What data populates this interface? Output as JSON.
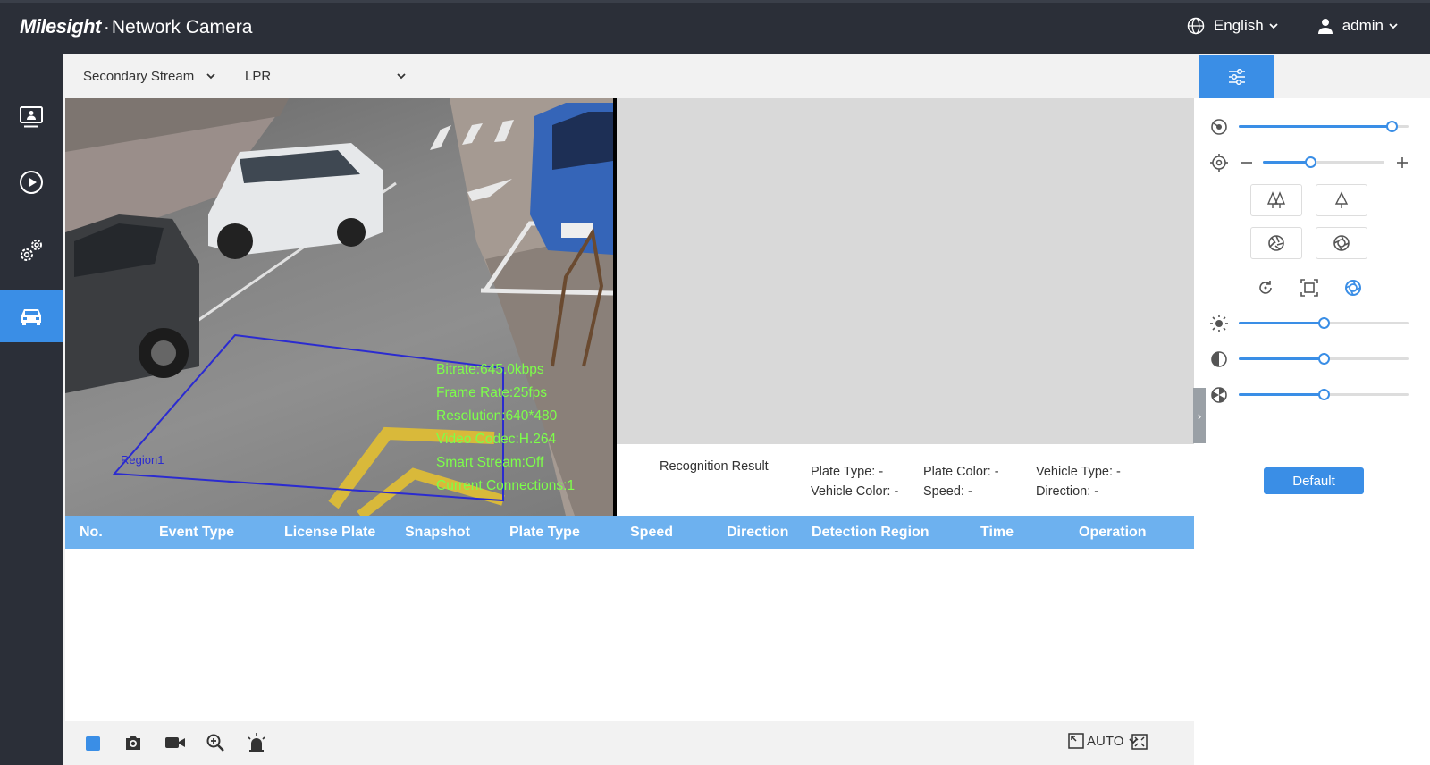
{
  "app": {
    "brand_logo": "Milesight",
    "brand_sep": "·",
    "brand_title": "Network Camera"
  },
  "header": {
    "language": "English",
    "user": "admin"
  },
  "sidebar": {
    "items": [
      {
        "name": "live-view",
        "icon": "monitor-icon",
        "active": false
      },
      {
        "name": "playback",
        "icon": "play-circle-icon",
        "active": false
      },
      {
        "name": "settings",
        "icon": "gears-icon",
        "active": false
      },
      {
        "name": "vehicle",
        "icon": "car-icon",
        "active": true
      }
    ]
  },
  "toolbar": {
    "stream": "Secondary Stream",
    "mode": "LPR"
  },
  "video": {
    "osd": [
      "Bitrate:645.0kbps",
      "Frame Rate:25fps",
      "Resolution:640*480",
      "Video Codec:H.264",
      "Smart Stream:Off",
      "Current Connections:1"
    ],
    "region_label": "Region1"
  },
  "recognition": {
    "title": "Recognition Result",
    "plate_type_label": "Plate Type:",
    "plate_type_value": "-",
    "plate_color_label": "Plate Color:",
    "plate_color_value": "-",
    "vehicle_type_label": "Vehicle Type:",
    "vehicle_type_value": "-",
    "vehicle_color_label": "Vehicle Color:",
    "vehicle_color_value": "-",
    "speed_label": "Speed:",
    "speed_value": "-",
    "direction_label": "Direction:",
    "direction_value": "-"
  },
  "table": {
    "columns": [
      "No.",
      "Event Type",
      "License Plate",
      "Snapshot",
      "Plate Type",
      "Speed",
      "Direction",
      "Detection Region",
      "Time",
      "Operation"
    ],
    "rows": []
  },
  "bottom": {
    "zoom_mode": "AUTO"
  },
  "panel": {
    "zoom_level": 0.9,
    "focus_level": 0.39,
    "brightness_level": 0.5,
    "contrast_level": 0.5,
    "saturation_level": 0.5,
    "default_label": "Default"
  },
  "colors": {
    "accent": "#3a8ee6",
    "header_bg": "#2b2f38",
    "table_header": "#6db1ef",
    "osd_text": "#7dff4a",
    "region_line": "#2b2bd0"
  }
}
